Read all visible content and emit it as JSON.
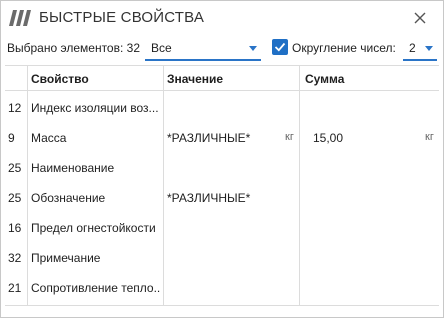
{
  "window": {
    "title": "БЫСТРЫЕ СВОЙСТВА"
  },
  "icons": {
    "logo": "logo-icon",
    "close": "close-icon",
    "checkbox": "checkmark-icon",
    "dropdown": "chevron-down-icon"
  },
  "toolbar": {
    "selected_label": "Выбрано элементов: 32",
    "filter_value": "Все",
    "rounding_checked": true,
    "rounding_label": "Округление чисел:",
    "rounding_value": "2"
  },
  "table": {
    "columns": [
      "Свойство",
      "Значение",
      "Сумма"
    ],
    "rows": [
      {
        "count": "12",
        "property": "Индекс изоляции воз...",
        "value": "",
        "unit": "",
        "sum": "",
        "sum_unit": ""
      },
      {
        "count": "9",
        "property": "Масса",
        "value": "*РАЗЛИЧНЫЕ*",
        "unit": "кг",
        "sum": "15,00",
        "sum_unit": "кг"
      },
      {
        "count": "25",
        "property": "Наименование",
        "value": "",
        "unit": "",
        "sum": "",
        "sum_unit": ""
      },
      {
        "count": "25",
        "property": "Обозначение",
        "value": "*РАЗЛИЧНЫЕ*",
        "unit": "",
        "sum": "",
        "sum_unit": ""
      },
      {
        "count": "16",
        "property": "Предел огнестойкости",
        "value": "",
        "unit": "",
        "sum": "",
        "sum_unit": ""
      },
      {
        "count": "32",
        "property": "Примечание",
        "value": "",
        "unit": "",
        "sum": "",
        "sum_unit": ""
      },
      {
        "count": "21",
        "property": "Сопротивление тепло...",
        "value": "",
        "unit": "",
        "sum": "",
        "sum_unit": ""
      }
    ]
  },
  "colors": {
    "accent": "#1f6fc5",
    "grid": "#dcdcdc"
  }
}
